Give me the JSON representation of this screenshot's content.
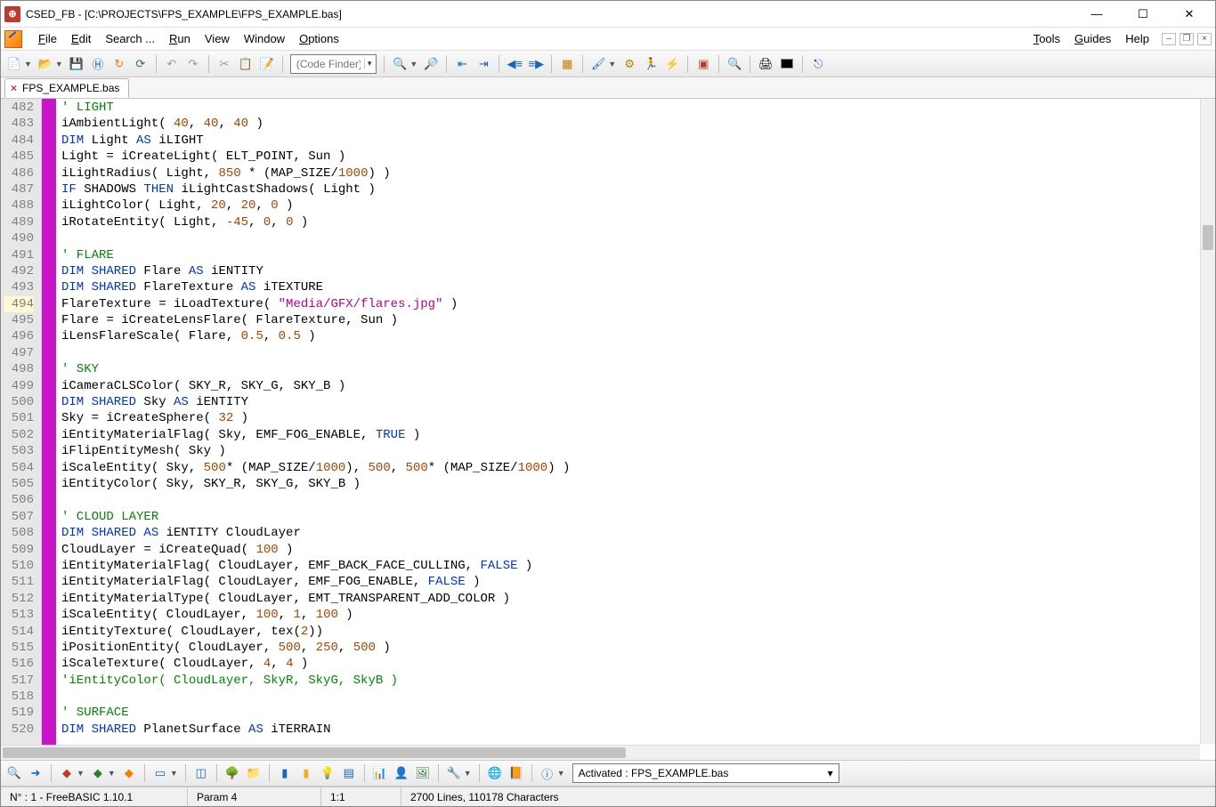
{
  "window": {
    "title": "CSED_FB - [C:\\PROJECTS\\FPS_EXAMPLE\\FPS_EXAMPLE.bas]"
  },
  "menu": {
    "file": "File",
    "edit": "Edit",
    "search": "Search ...",
    "run": "Run",
    "view": "View",
    "window": "Window",
    "options": "Options",
    "tools": "Tools",
    "guides": "Guides",
    "help": "Help"
  },
  "code_finder": {
    "placeholder": "(Code Finder)"
  },
  "tab": {
    "name": "FPS_EXAMPLE.bas"
  },
  "activated": {
    "label": "Activated :  FPS_EXAMPLE.bas"
  },
  "status": {
    "left": "N° : 1  -  FreeBASIC  1.10.1",
    "param": "Param 4",
    "pos": "1:1",
    "info": "2700 Lines,   110178 Characters"
  },
  "first_line": 482,
  "current_line_index": 12,
  "code_lines": [
    [
      [
        "com",
        "' LIGHT"
      ]
    ],
    [
      [
        "id",
        "iAmbientLight( "
      ],
      [
        "num",
        "40"
      ],
      [
        "id",
        ", "
      ],
      [
        "num",
        "40"
      ],
      [
        "id",
        ", "
      ],
      [
        "num",
        "40"
      ],
      [
        "id",
        " )"
      ]
    ],
    [
      [
        "kw",
        "DIM"
      ],
      [
        "id",
        " Light "
      ],
      [
        "kw",
        "AS"
      ],
      [
        "id",
        " iLIGHT"
      ]
    ],
    [
      [
        "id",
        "Light = iCreateLight( ELT_POINT, Sun )"
      ]
    ],
    [
      [
        "id",
        "iLightRadius( Light, "
      ],
      [
        "num",
        "850"
      ],
      [
        "id",
        " * (MAP_SIZE/"
      ],
      [
        "num",
        "1000"
      ],
      [
        "id",
        ") )"
      ]
    ],
    [
      [
        "kw",
        "IF"
      ],
      [
        "id",
        " SHADOWS "
      ],
      [
        "kw",
        "THEN"
      ],
      [
        "id",
        " iLightCastShadows( Light )"
      ]
    ],
    [
      [
        "id",
        "iLightColor( Light, "
      ],
      [
        "num",
        "20"
      ],
      [
        "id",
        ", "
      ],
      [
        "num",
        "20"
      ],
      [
        "id",
        ", "
      ],
      [
        "num",
        "0"
      ],
      [
        "id",
        " )"
      ]
    ],
    [
      [
        "id",
        "iRotateEntity( Light, "
      ],
      [
        "num",
        "-45"
      ],
      [
        "id",
        ", "
      ],
      [
        "num",
        "0"
      ],
      [
        "id",
        ", "
      ],
      [
        "num",
        "0"
      ],
      [
        "id",
        " )"
      ]
    ],
    [],
    [
      [
        "com",
        "' FLARE"
      ]
    ],
    [
      [
        "kw",
        "DIM SHARED"
      ],
      [
        "id",
        " Flare "
      ],
      [
        "kw",
        "AS"
      ],
      [
        "id",
        " iENTITY"
      ]
    ],
    [
      [
        "kw",
        "DIM SHARED"
      ],
      [
        "id",
        " FlareTexture "
      ],
      [
        "kw",
        "AS"
      ],
      [
        "id",
        " iTEXTURE"
      ]
    ],
    [
      [
        "id",
        "FlareTexture = iLoadTexture( "
      ],
      [
        "str",
        "\"Media/GFX/flares.jpg\""
      ],
      [
        "id",
        " )"
      ]
    ],
    [
      [
        "id",
        "Flare = iCreateLensFlare( FlareTexture, Sun )"
      ]
    ],
    [
      [
        "id",
        "iLensFlareScale( Flare, "
      ],
      [
        "num",
        "0.5"
      ],
      [
        "id",
        ", "
      ],
      [
        "num",
        "0.5"
      ],
      [
        "id",
        " )"
      ]
    ],
    [],
    [
      [
        "com",
        "' SKY"
      ]
    ],
    [
      [
        "id",
        "iCameraCLSColor( SKY_R, SKY_G, SKY_B )"
      ]
    ],
    [
      [
        "kw",
        "DIM SHARED"
      ],
      [
        "id",
        " Sky "
      ],
      [
        "kw",
        "AS"
      ],
      [
        "id",
        " iENTITY"
      ]
    ],
    [
      [
        "id",
        "Sky = iCreateSphere( "
      ],
      [
        "num",
        "32"
      ],
      [
        "id",
        " )"
      ]
    ],
    [
      [
        "id",
        "iEntityMaterialFlag( Sky, EMF_FOG_ENABLE, "
      ],
      [
        "kw",
        "TRUE"
      ],
      [
        "id",
        " )"
      ]
    ],
    [
      [
        "id",
        "iFlipEntityMesh( Sky )"
      ]
    ],
    [
      [
        "id",
        "iScaleEntity( Sky, "
      ],
      [
        "num",
        "500"
      ],
      [
        "id",
        "* (MAP_SIZE/"
      ],
      [
        "num",
        "1000"
      ],
      [
        "id",
        "), "
      ],
      [
        "num",
        "500"
      ],
      [
        "id",
        ", "
      ],
      [
        "num",
        "500"
      ],
      [
        "id",
        "* (MAP_SIZE/"
      ],
      [
        "num",
        "1000"
      ],
      [
        "id",
        ") )"
      ]
    ],
    [
      [
        "id",
        "iEntityColor( Sky, SKY_R, SKY_G, SKY_B )"
      ]
    ],
    [],
    [
      [
        "com",
        "' CLOUD LAYER"
      ]
    ],
    [
      [
        "kw",
        "DIM SHARED AS"
      ],
      [
        "id",
        " iENTITY CloudLayer"
      ]
    ],
    [
      [
        "id",
        "CloudLayer = iCreateQuad( "
      ],
      [
        "num",
        "100"
      ],
      [
        "id",
        " )"
      ]
    ],
    [
      [
        "id",
        "iEntityMaterialFlag( CloudLayer, EMF_BACK_FACE_CULLING, "
      ],
      [
        "kw",
        "FALSE"
      ],
      [
        "id",
        " )"
      ]
    ],
    [
      [
        "id",
        "iEntityMaterialFlag( CloudLayer, EMF_FOG_ENABLE, "
      ],
      [
        "kw",
        "FALSE"
      ],
      [
        "id",
        " )"
      ]
    ],
    [
      [
        "id",
        "iEntityMaterialType( CloudLayer, EMT_TRANSPARENT_ADD_COLOR )"
      ]
    ],
    [
      [
        "id",
        "iScaleEntity( CloudLayer, "
      ],
      [
        "num",
        "100"
      ],
      [
        "id",
        ", "
      ],
      [
        "num",
        "1"
      ],
      [
        "id",
        ", "
      ],
      [
        "num",
        "100"
      ],
      [
        "id",
        " )"
      ]
    ],
    [
      [
        "id",
        "iEntityTexture( CloudLayer, tex("
      ],
      [
        "num",
        "2"
      ],
      [
        "id",
        "))"
      ]
    ],
    [
      [
        "id",
        "iPositionEntity( CloudLayer, "
      ],
      [
        "num",
        "500"
      ],
      [
        "id",
        ", "
      ],
      [
        "num",
        "250"
      ],
      [
        "id",
        ", "
      ],
      [
        "num",
        "500"
      ],
      [
        "id",
        " )"
      ]
    ],
    [
      [
        "id",
        "iScaleTexture( CloudLayer, "
      ],
      [
        "num",
        "4"
      ],
      [
        "id",
        ", "
      ],
      [
        "num",
        "4"
      ],
      [
        "id",
        " )"
      ]
    ],
    [
      [
        "com",
        "'iEntityColor( CloudLayer, SkyR, SkyG, SkyB )"
      ]
    ],
    [],
    [
      [
        "com",
        "' SURFACE"
      ]
    ],
    [
      [
        "kw",
        "DIM SHARED"
      ],
      [
        "id",
        " PlanetSurface "
      ],
      [
        "kw",
        "AS"
      ],
      [
        "id",
        " iTERRAIN"
      ]
    ]
  ]
}
